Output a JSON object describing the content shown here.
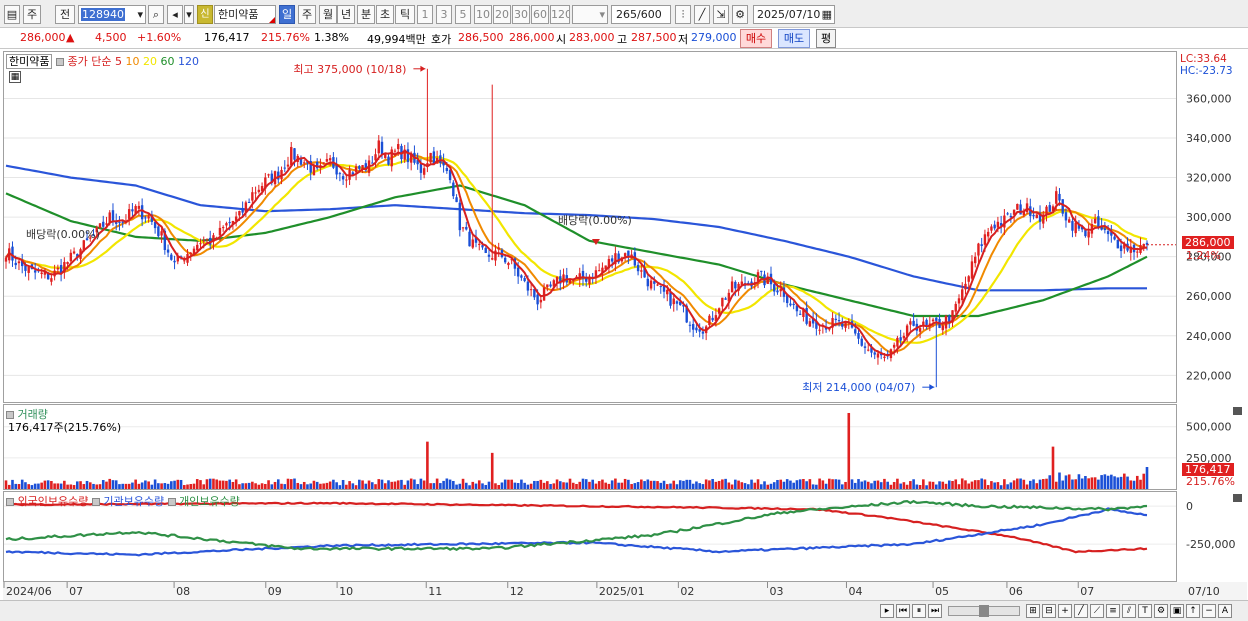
{
  "toolbar": {
    "buttons": [
      "주",
      "전"
    ],
    "code": "128940",
    "badge": "신",
    "stock_name": "한미약품",
    "periods": [
      "일",
      "주",
      "월",
      "년",
      "분",
      "초",
      "틱"
    ],
    "active_period": "일",
    "intervals": [
      "1",
      "3",
      "5",
      "10",
      "20",
      "30",
      "60",
      "120"
    ],
    "count": "265",
    "count_total": "/600",
    "date": "2025/07/10"
  },
  "info": {
    "price": "286,000",
    "change_arrow": "▲",
    "change": "4,500",
    "change_pct": "+1.60%",
    "volume": "176,417",
    "volume_pct": "215.76%",
    "turnover": "1.38%",
    "amount": "49,994백만",
    "ask_label": "호가",
    "ask1": "286,500",
    "ask2": "286,000",
    "open_label": "시",
    "open": "283,000",
    "high_label": "고",
    "high": "287,500",
    "low_label": "저",
    "low": "279,000",
    "buy_label": "매수",
    "sell_label": "매도",
    "eval_label": "평"
  },
  "price_pane": {
    "stock_name": "한미약품",
    "ma_label": "종가 단순",
    "ma_periods": [
      "5",
      "10",
      "20",
      "60",
      "120"
    ],
    "lc": "LC:33.64",
    "hc": "HC:-23.73",
    "high_annot": "최고 375,000 (10/18)",
    "low_annot": "최저 214,000 (04/07)",
    "div_annot1": "배당락(0.00%)",
    "div_annot2": "배당락(0.00%)",
    "last_price": "286,000",
    "last_pct": "1.24%"
  },
  "volume_pane": {
    "title": "거래량",
    "summary": "176,417주(215.76%)",
    "last_volume": "176,417",
    "last_pct": "215.76%"
  },
  "holding_pane": {
    "series": [
      "외국인보유수량",
      "기관보유수량",
      "개인보유수량"
    ]
  },
  "colors": {
    "up": "#e02020",
    "down": "#1a4fd6",
    "ma5": "#d62020",
    "ma10": "#f08a00",
    "ma20": "#f2e600",
    "ma60": "#1f8f2a",
    "ma120": "#2a55d9",
    "foreign": "#d62020",
    "institution": "#2a55d9",
    "individual": "#2f9046"
  },
  "chart_data": [
    {
      "type": "candlestick",
      "x_months": [
        "2024/06",
        "07",
        "08",
        "09",
        "10",
        "11",
        "12",
        "2025/01",
        "02",
        "03",
        "04",
        "05",
        "06",
        "07",
        "07/10"
      ],
      "y_ticks": [
        "360,000",
        "340,000",
        "320,000",
        "300,000",
        "280,000",
        "260,000",
        "240,000",
        "220,000"
      ],
      "ylim": [
        206000,
        384000
      ],
      "close_path": [
        [
          0,
          283000
        ],
        [
          4,
          276000
        ],
        [
          8,
          272000
        ],
        [
          14,
          270000
        ],
        [
          18,
          276000
        ],
        [
          22,
          282000
        ],
        [
          28,
          292000
        ],
        [
          32,
          300000
        ],
        [
          36,
          298000
        ],
        [
          40,
          304000
        ],
        [
          44,
          300000
        ],
        [
          48,
          290000
        ],
        [
          52,
          276000
        ],
        [
          56,
          282000
        ],
        [
          60,
          288000
        ],
        [
          64,
          288000
        ],
        [
          68,
          296000
        ],
        [
          72,
          300000
        ],
        [
          76,
          312000
        ],
        [
          80,
          318000
        ],
        [
          84,
          322000
        ],
        [
          88,
          332000
        ],
        [
          92,
          328000
        ],
        [
          96,
          322000
        ],
        [
          100,
          328000
        ],
        [
          104,
          322000
        ],
        [
          108,
          324000
        ],
        [
          112,
          326000
        ],
        [
          115,
          336000
        ],
        [
          118,
          330000
        ],
        [
          121,
          334000
        ],
        [
          124,
          330000
        ],
        [
          128,
          324000
        ],
        [
          131,
          332000
        ],
        [
          134,
          326000
        ],
        [
          137,
          322000
        ],
        [
          140,
          296000
        ],
        [
          144,
          286000
        ],
        [
          148,
          280000
        ],
        [
          152,
          282000
        ],
        [
          156,
          276000
        ],
        [
          160,
          266000
        ],
        [
          164,
          258000
        ],
        [
          168,
          264000
        ],
        [
          172,
          270000
        ],
        [
          176,
          268000
        ],
        [
          180,
          270000
        ],
        [
          184,
          274000
        ],
        [
          188,
          280000
        ],
        [
          192,
          282000
        ],
        [
          196,
          272000
        ],
        [
          200,
          264000
        ],
        [
          204,
          260000
        ],
        [
          208,
          254000
        ],
        [
          212,
          246000
        ],
        [
          216,
          244000
        ],
        [
          220,
          256000
        ],
        [
          224,
          264000
        ],
        [
          228,
          266000
        ],
        [
          232,
          270000
        ],
        [
          236,
          266000
        ],
        [
          240,
          262000
        ],
        [
          244,
          252000
        ],
        [
          248,
          248000
        ],
        [
          252,
          246000
        ],
        [
          256,
          246000
        ],
        [
          260,
          244000
        ],
        [
          264,
          236000
        ],
        [
          268,
          230000
        ],
        [
          272,
          228000
        ],
        [
          276,
          238000
        ],
        [
          280,
          246000
        ],
        [
          284,
          244000
        ],
        [
          288,
          246000
        ],
        [
          292,
          250000
        ],
        [
          296,
          266000
        ],
        [
          300,
          284000
        ],
        [
          304,
          296000
        ],
        [
          308,
          298000
        ],
        [
          312,
          304000
        ],
        [
          316,
          304000
        ],
        [
          320,
          300000
        ],
        [
          324,
          310000
        ],
        [
          328,
          298000
        ],
        [
          332,
          292000
        ],
        [
          336,
          296000
        ],
        [
          340,
          290000
        ],
        [
          344,
          286000
        ],
        [
          348,
          284000
        ],
        [
          352,
          286000
        ]
      ],
      "ma60_path": [
        [
          0,
          312000
        ],
        [
          20,
          298000
        ],
        [
          40,
          290000
        ],
        [
          60,
          288000
        ],
        [
          80,
          292000
        ],
        [
          100,
          300000
        ],
        [
          120,
          310000
        ],
        [
          140,
          316000
        ],
        [
          160,
          306000
        ],
        [
          180,
          288000
        ],
        [
          200,
          282000
        ],
        [
          220,
          276000
        ],
        [
          240,
          266000
        ],
        [
          260,
          258000
        ],
        [
          280,
          250000
        ],
        [
          300,
          250000
        ],
        [
          320,
          258000
        ],
        [
          340,
          270000
        ],
        [
          352,
          280000
        ]
      ],
      "ma120_path": [
        [
          0,
          326000
        ],
        [
          20,
          320000
        ],
        [
          40,
          316000
        ],
        [
          60,
          306000
        ],
        [
          80,
          303000
        ],
        [
          100,
          304000
        ],
        [
          120,
          306000
        ],
        [
          140,
          304000
        ],
        [
          160,
          302000
        ],
        [
          180,
          301000
        ],
        [
          200,
          299000
        ],
        [
          220,
          295000
        ],
        [
          240,
          288000
        ],
        [
          260,
          280000
        ],
        [
          280,
          270000
        ],
        [
          300,
          263000
        ],
        [
          320,
          263000
        ],
        [
          340,
          264000
        ],
        [
          352,
          264000
        ]
      ],
      "annotations": [
        {
          "label": "최고",
          "value": 375000,
          "date": "10/18"
        },
        {
          "label": "최저",
          "value": 214000,
          "date": "04/07"
        }
      ]
    },
    {
      "type": "bar",
      "name": "거래량",
      "y_ticks": [
        "500,000",
        "250,000"
      ],
      "ylim": [
        0,
        650000
      ],
      "spikes": [
        {
          "idx": 130,
          "value": 380000
        },
        {
          "idx": 150,
          "value": 290000
        },
        {
          "idx": 260,
          "value": 610000
        },
        {
          "idx": 323,
          "value": 340000
        }
      ]
    },
    {
      "type": "line",
      "name": "보유수량",
      "y_ticks": [
        "0",
        "-250,000"
      ],
      "ylim": [
        -500000,
        100000
      ]
    }
  ]
}
